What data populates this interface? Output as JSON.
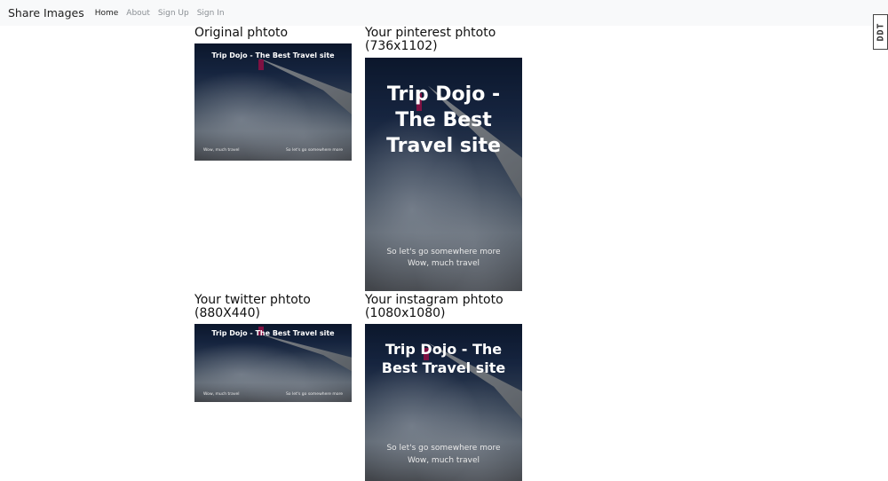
{
  "navbar": {
    "brand": "Share Images",
    "links": [
      {
        "label": "Home",
        "active": true
      },
      {
        "label": "About",
        "active": false
      },
      {
        "label": "Sign Up",
        "active": false
      },
      {
        "label": "Sign In",
        "active": false
      }
    ]
  },
  "ddt_badge": "DDT",
  "photo_text": {
    "title": "Trip Dojo - The Best Travel site",
    "line1": "So let's go somewhere more",
    "line2": "Wow, much travel"
  },
  "cards": {
    "original": {
      "label": "Original phtoto"
    },
    "pinterest": {
      "label": "Your pinterest phtoto",
      "dims": "(736x1102)"
    },
    "twitter": {
      "label": "Your twitter phtoto",
      "dims": "(880X440)"
    },
    "instagram": {
      "label": "Your instagram phtoto",
      "dims": "(1080x1080)"
    }
  }
}
